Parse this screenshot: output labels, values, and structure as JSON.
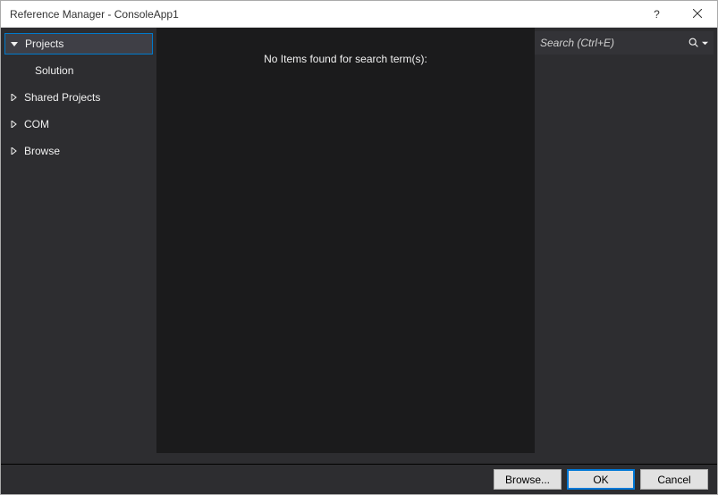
{
  "title": "Reference Manager - ConsoleApp1",
  "sidebar": {
    "items": [
      {
        "label": "Projects",
        "sub": [
          {
            "label": "Solution"
          }
        ]
      },
      {
        "label": "Shared Projects"
      },
      {
        "label": "COM"
      },
      {
        "label": "Browse"
      }
    ]
  },
  "main": {
    "empty_message": "No Items found for search term(s):"
  },
  "search": {
    "placeholder": "Search (Ctrl+E)"
  },
  "footer": {
    "browse_label": "Browse...",
    "ok_label": "OK",
    "cancel_label": "Cancel"
  },
  "titlebar": {
    "help": "?"
  }
}
